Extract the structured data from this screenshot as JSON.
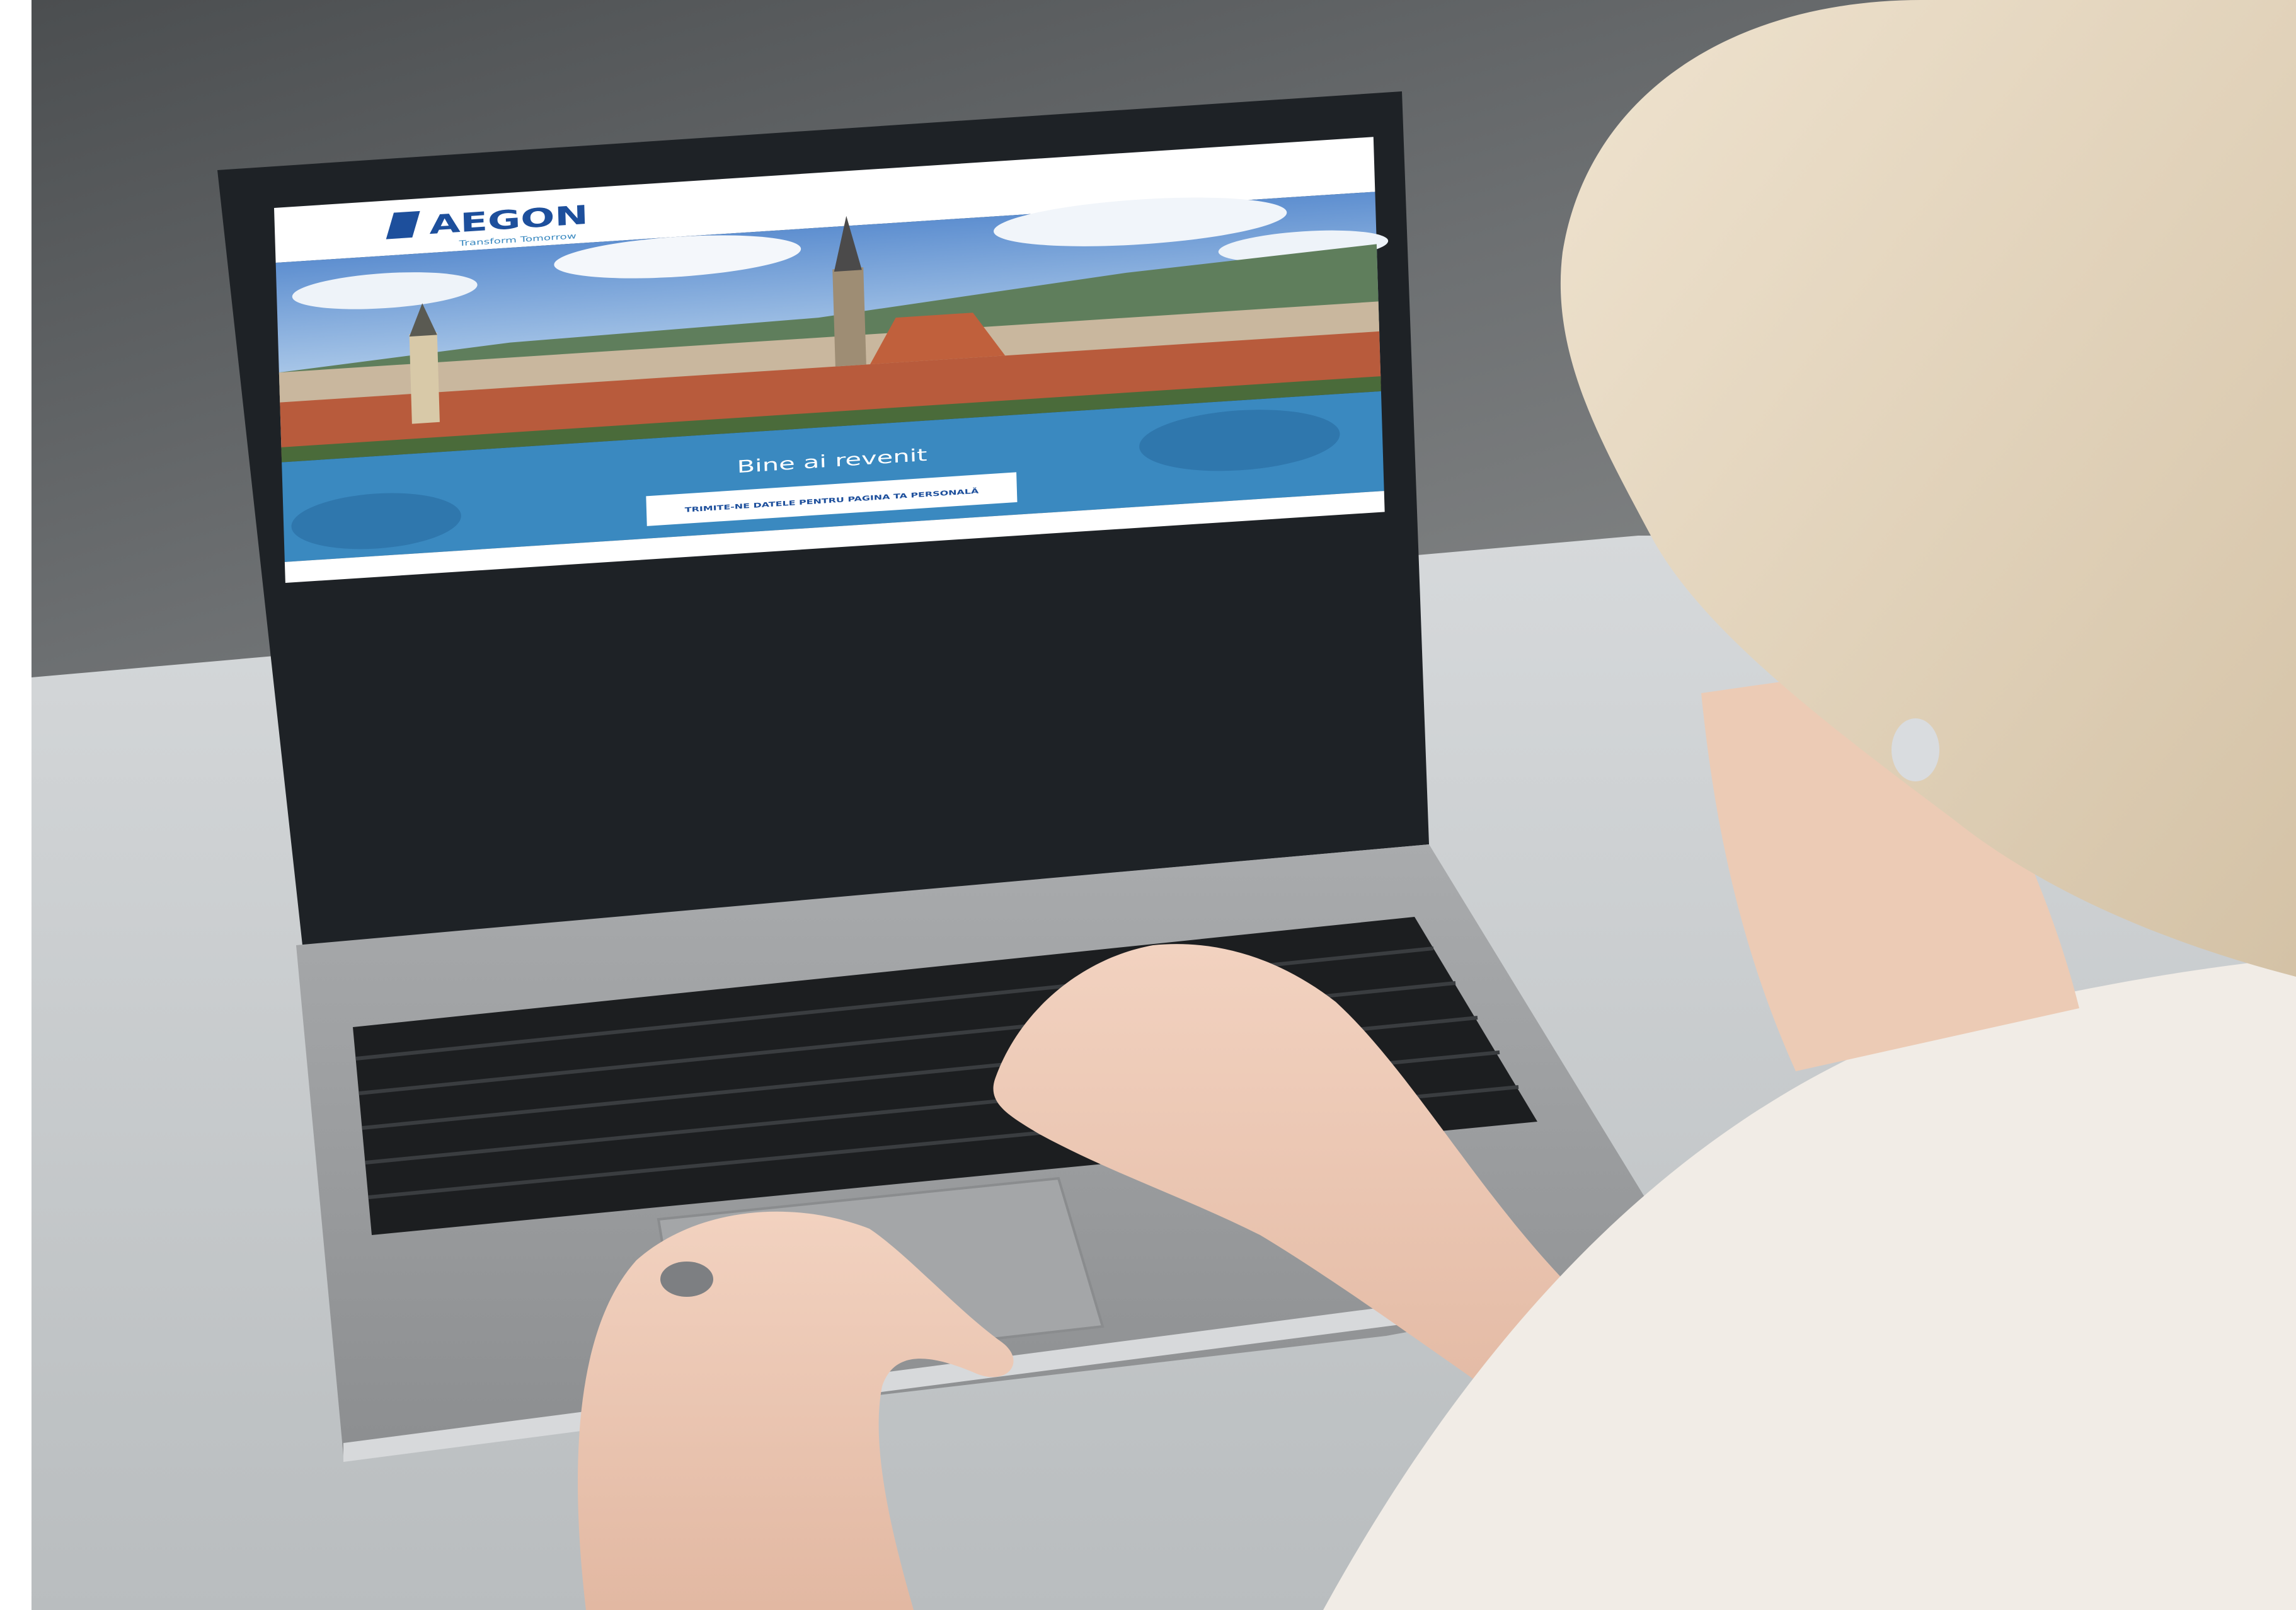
{
  "website": {
    "brand": {
      "name": "AEGON",
      "tagline": "Transform Tomorrow"
    },
    "hero": {
      "scene": "city-skyline-photo"
    },
    "banner": {
      "heading": "Bine ai revenit",
      "cta_label": "TRIMITE-NE DATELE PENTRU PAGINA TA PERSONALĂ"
    }
  },
  "colors": {
    "brand_blue": "#1d4f9c",
    "banner_blue": "#3a89c0",
    "laptop_bezel": "#1e2226",
    "laptop_body": "#9a9c9e",
    "desk": "#c8cbcd",
    "wall": "#5e6163"
  }
}
